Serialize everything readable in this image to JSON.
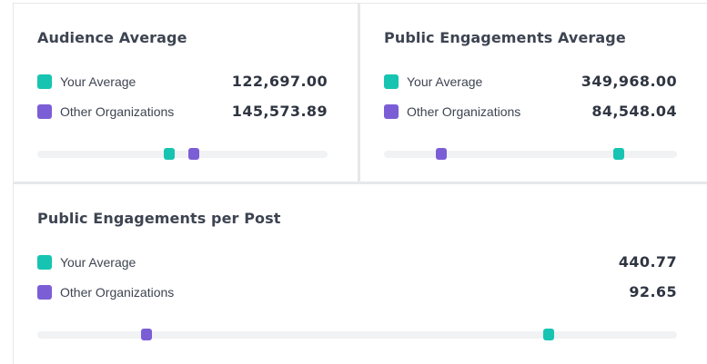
{
  "colors": {
    "your_average": "#17c4b2",
    "other_organizations": "#7b5ed6",
    "track": "#f1f2f4"
  },
  "cards": [
    {
      "title": "Audience Average",
      "your_label": "Your Average",
      "your_value": "122,697.00",
      "other_label": "Other Organizations",
      "other_value": "145,573.89",
      "your_position": 0.455,
      "other_position": 0.54
    },
    {
      "title": "Public Engagements Average",
      "your_label": "Your Average",
      "your_value": "349,968.00",
      "other_label": "Other Organizations",
      "other_value": "84,548.04",
      "your_position": 0.8,
      "other_position": 0.195
    },
    {
      "title": "Public Engagements per Post",
      "your_label": "Your Average",
      "your_value": "440.77",
      "other_label": "Other Organizations",
      "other_value": "92.65",
      "your_position": 0.8,
      "other_position": 0.17
    }
  ]
}
